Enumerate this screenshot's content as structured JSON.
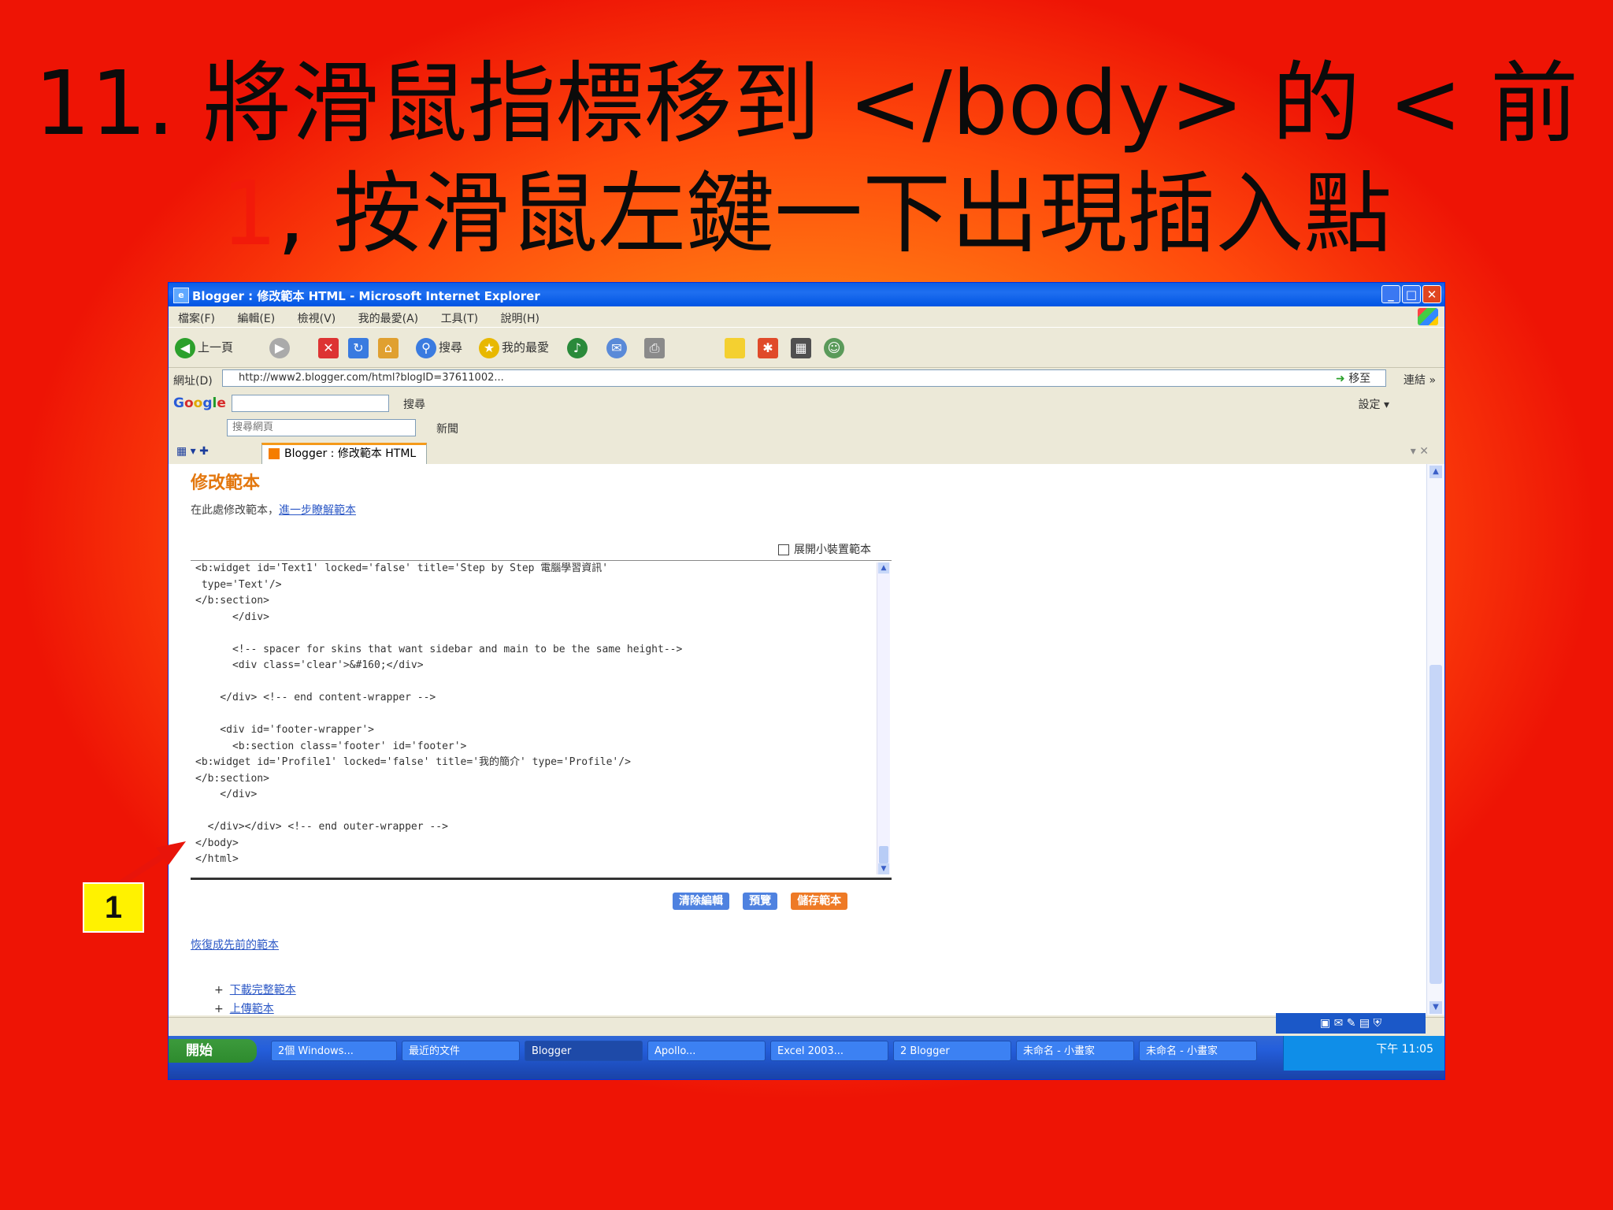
{
  "slide": {
    "title_line1": "11. 將滑鼠指標移到 </body> 的 < 前",
    "title_line2_number": "1",
    "title_line2_text": ", 按滑鼠左鍵一下出現插入點",
    "callout_label": "1"
  },
  "window": {
    "title": "Blogger : 修改範本 HTML - Microsoft Internet Explorer",
    "controls": {
      "minimize": "_",
      "maximize": "□",
      "close": "✕"
    },
    "menu": [
      "檔案(F)",
      "編輯(E)",
      "檢視(V)",
      "我的最愛(A)",
      "工具(T)",
      "說明(H)"
    ],
    "toolbar": {
      "back": "上一頁",
      "search": "搜尋",
      "favorites": "我的最愛"
    },
    "address": {
      "label": "網址(D)",
      "url": "http://www2.blogger.com/html?blogID=37611002...",
      "go": "移至",
      "links": "連結 »"
    },
    "googlebar": {
      "search_btn": "搜尋",
      "settings": "設定 ▾"
    },
    "thirdbar": {
      "search_placeholder": "搜尋網頁",
      "news_label": "新聞"
    },
    "tab": {
      "label": "Blogger : 修改範本 HTML"
    }
  },
  "page": {
    "heading": "修改範本",
    "desc_text": "在此處修改範本，",
    "desc_link": "進一步瞭解範本",
    "expand_widget": "展開小裝置範本",
    "code_lines": [
      "<b:widget id='Text1' locked='false' title='Step by Step 電腦學習資訊'",
      " type='Text'/>",
      "</b:section>",
      "      </div>",
      "",
      "      <!-- spacer for skins that want sidebar and main to be the same height-->",
      "      <div class='clear'>&#160;</div>",
      "",
      "    </div> <!-- end content-wrapper -->",
      "",
      "    <div id='footer-wrapper'>",
      "      <b:section class='footer' id='footer'>",
      "<b:widget id='Profile1' locked='false' title='我的簡介' type='Profile'/>",
      "</b:section>",
      "    </div>",
      "",
      "  </div></div> <!-- end outer-wrapper -->",
      "</body>",
      "</html>"
    ],
    "buttons": {
      "clear_edits": "清除編輯",
      "preview": "預覽",
      "save_template": "儲存範本"
    },
    "revert_link": "恢復成先前的範本",
    "extra_links": [
      "下載完整範本",
      "上傳範本"
    ]
  },
  "taskbar": {
    "start": "開始",
    "tasks": [
      "2個 Windows...",
      "最近的文件",
      "Blogger",
      "Apollo...",
      "Excel 2003...",
      "2 Blogger",
      "未命名 - 小畫家",
      "未命名 - 小畫家"
    ],
    "clock": "下午 11:05"
  },
  "colors": {
    "slide_bg_center": "#ff9a18",
    "slide_bg_edge": "#ee1405",
    "title_text": "#0b0b0b",
    "title_accent": "#f21a0a",
    "callout_bg": "#fff200",
    "arrow": "#e8140a",
    "blogger_orange": "#e3770e",
    "link_blue": "#2c58c6"
  },
  "icons": [
    "back-icon",
    "forward-icon",
    "stop-icon",
    "refresh-icon",
    "home-icon",
    "search-icon",
    "favorites-icon",
    "media-icon",
    "mail-icon",
    "print-icon",
    "go-icon",
    "google-logo",
    "tab-icon",
    "checkbox-icon",
    "scroll-arrow-icon",
    "windows-logo-icon",
    "arrow-annotation"
  ]
}
